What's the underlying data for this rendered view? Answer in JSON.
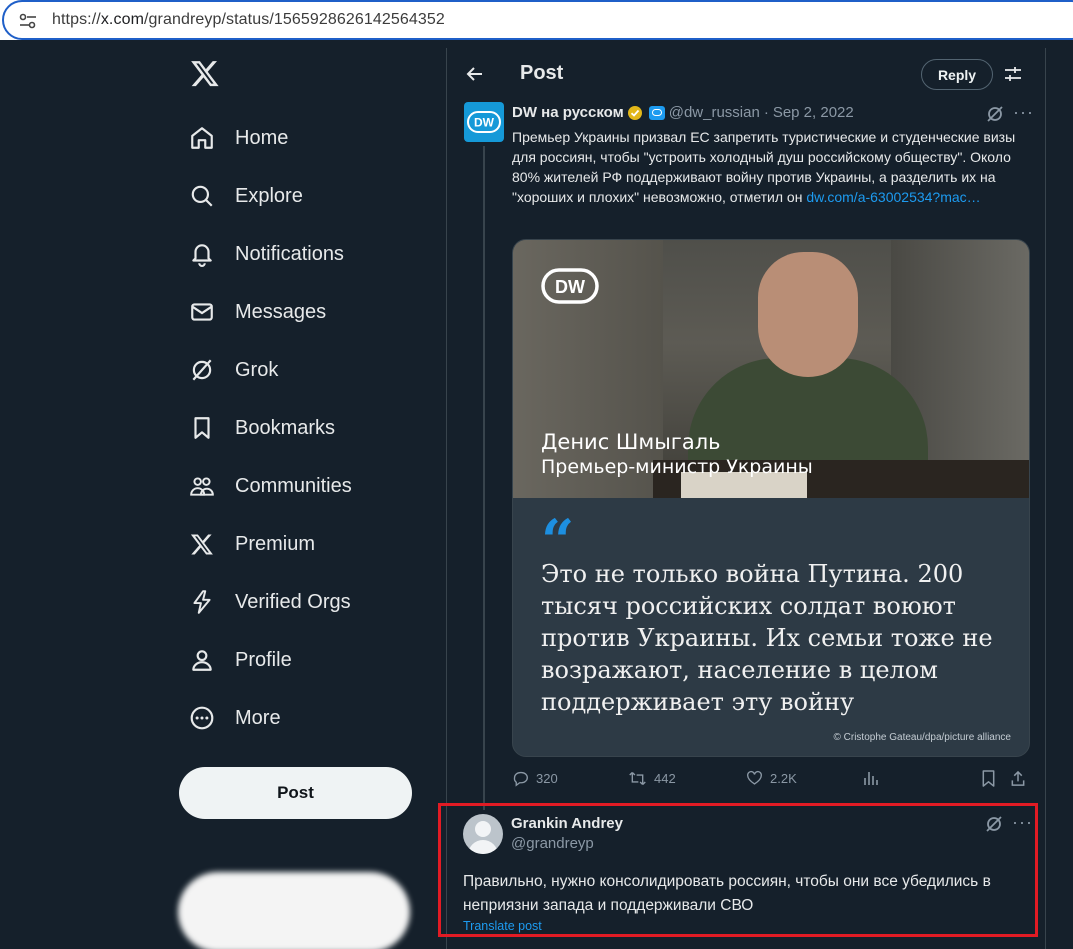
{
  "browser": {
    "url_prefix": "https://",
    "url_host": "x.com",
    "url_path": "/grandreyp/status/1565928626142564352",
    "site_info_icon": "tune-icon"
  },
  "nav": {
    "logo": "x-logo",
    "items": [
      {
        "label": "Home",
        "icon": "home-icon"
      },
      {
        "label": "Explore",
        "icon": "search-icon"
      },
      {
        "label": "Notifications",
        "icon": "bell-icon"
      },
      {
        "label": "Messages",
        "icon": "envelope-icon"
      },
      {
        "label": "Grok",
        "icon": "grok-icon"
      },
      {
        "label": "Bookmarks",
        "icon": "bookmark-icon"
      },
      {
        "label": "Communities",
        "icon": "people-icon"
      },
      {
        "label": "Premium",
        "icon": "x-icon"
      },
      {
        "label": "Verified Orgs",
        "icon": "lightning-icon"
      },
      {
        "label": "Profile",
        "icon": "person-icon"
      },
      {
        "label": "More",
        "icon": "more-circle-icon"
      }
    ],
    "post_label": "Post"
  },
  "header": {
    "title": "Post",
    "reply_label": "Reply"
  },
  "tweet": {
    "name": "DW на русском",
    "handle": "@dw_russian",
    "date": "Sep 2, 2022",
    "text": "Премьер Украины призвал ЕС запретить туристические и студенческие визы для россиян, чтобы \"устроить холодный душ российскому обществу\". Около 80% жителей РФ поддерживают войну против Украины, а разделить их на \"хороших и плохих\" невозможно, отметил он ",
    "link": "dw.com/a-63002534?mac…",
    "media": {
      "logo_text": "DW",
      "caption_name": "Денис Шмыгаль",
      "caption_title": "Премьер-министр Украины",
      "quote_mark": "“",
      "quote": "Это не только война Путина. 200 тысяч российских солдат воюют против Украины. Их семьи тоже не возражают, население в целом поддерживает эту войну",
      "credit": "© Cristophe Gateau/dpa/picture alliance"
    },
    "stats": {
      "replies": "320",
      "reposts": "442",
      "likes": "2.2K"
    }
  },
  "reply": {
    "name": "Grankin Andrey",
    "handle": "@grandreyp",
    "text": "Правильно, нужно консолидировать россиян, чтобы они все убедились в неприязни запада и поддерживали СВО",
    "translate": "Translate post"
  },
  "colors": {
    "background": "#15202b",
    "accent": "#1d9bf0",
    "highlight_box": "#e21b24"
  }
}
